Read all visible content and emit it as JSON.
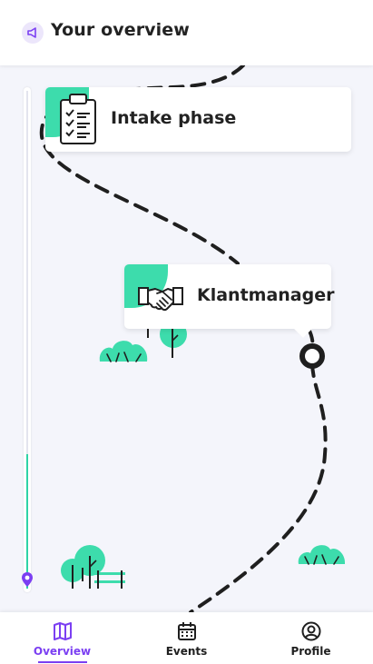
{
  "header": {
    "title": "Your overview",
    "icon": "megaphone-icon",
    "accent": "#7b3ff2"
  },
  "map": {
    "path_color": "#1f1f1f",
    "accent_green": "#3ddcac",
    "milestones": [
      {
        "label": "Intake phase",
        "icon": "clipboard-checklist-icon"
      },
      {
        "label": "Klantmanager",
        "icon": "handshake-icon"
      }
    ],
    "progress_fraction": 0.27
  },
  "bottom_nav": {
    "items": [
      {
        "label": "Overview",
        "icon": "map-icon",
        "active": true
      },
      {
        "label": "Events",
        "icon": "calendar-icon",
        "active": false
      },
      {
        "label": "Profile",
        "icon": "user-circle-icon",
        "active": false
      }
    ]
  }
}
